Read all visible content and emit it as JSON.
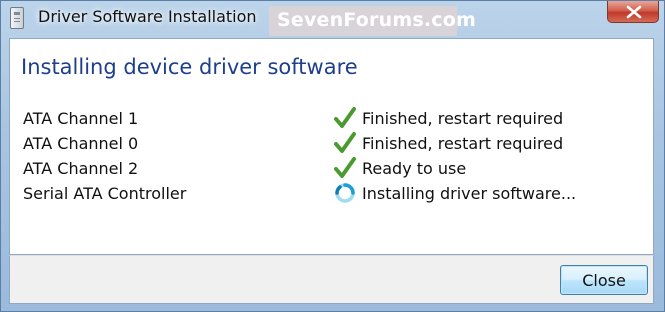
{
  "window": {
    "title": "Driver Software Installation",
    "watermark": "SevenForums.com"
  },
  "main": {
    "heading": "Installing device driver software",
    "devices": [
      {
        "name": "ATA Channel 1",
        "status": "Finished, restart required",
        "icon": "check-icon"
      },
      {
        "name": "ATA Channel 0",
        "status": "Finished, restart required",
        "icon": "check-icon"
      },
      {
        "name": "ATA Channel 2",
        "status": "Ready to use",
        "icon": "check-icon"
      },
      {
        "name": "Serial ATA Controller",
        "status": "Installing driver software...",
        "icon": "busy-spinner-icon"
      }
    ]
  },
  "footer": {
    "close_label": "Close"
  },
  "colors": {
    "heading": "#1e3f8b",
    "check": "#4a9a2e",
    "spinner": "#1aa0d8"
  }
}
